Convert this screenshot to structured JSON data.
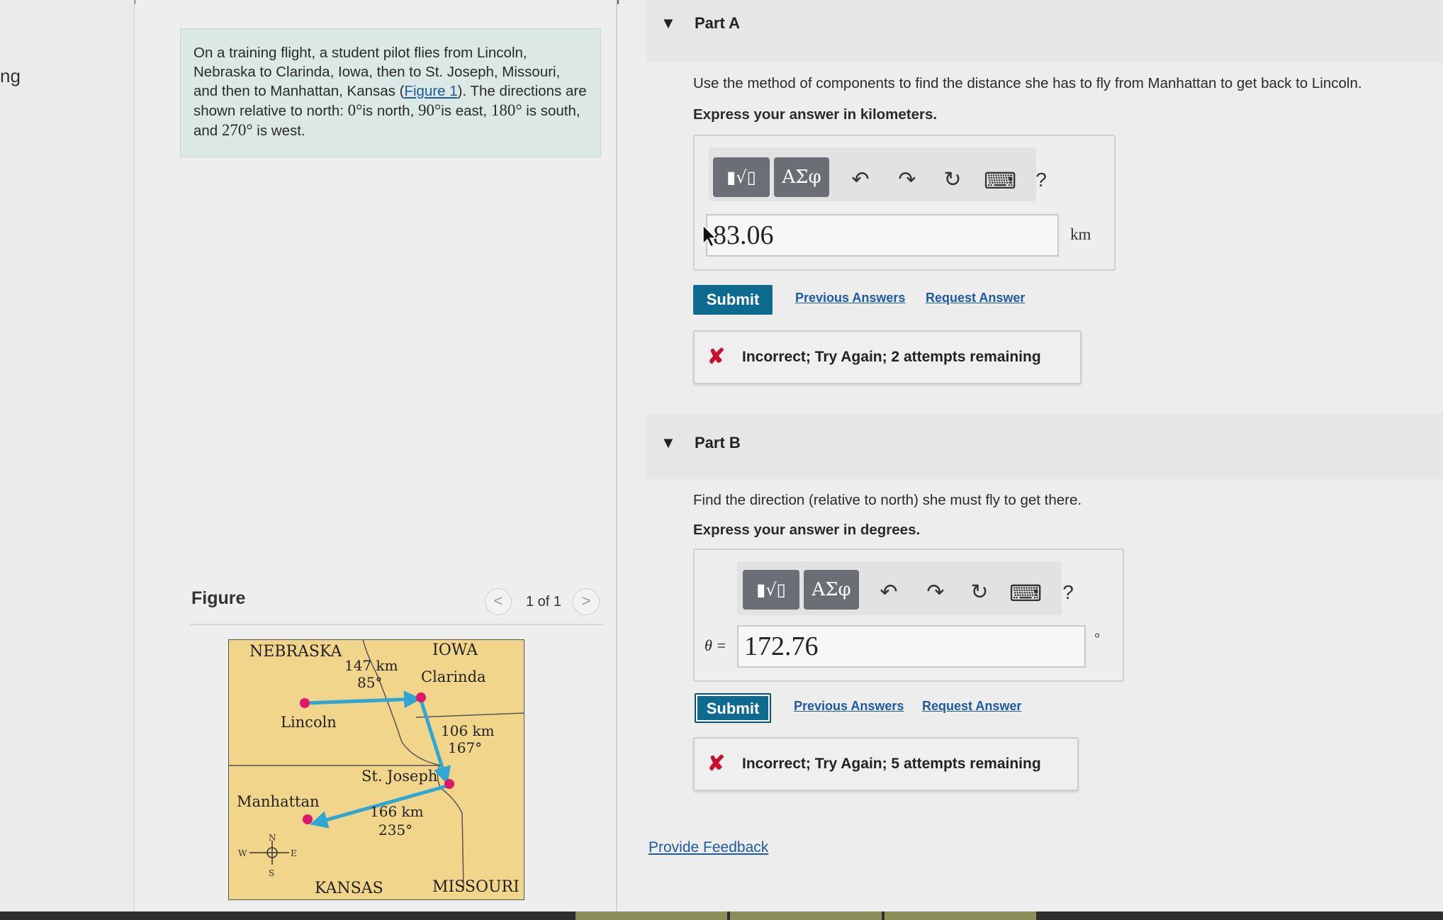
{
  "left_edge_text": "ng",
  "problem": {
    "segments": [
      {
        "t": "On a training flight, a student pilot flies from Lincoln, Nebraska to Clarinda, Iowa, then to St. Joseph, Missouri, and then to Manhattan, Kansas ("
      },
      {
        "t": "Figure 1",
        "link": true
      },
      {
        "t": "). The directions are shown relative to north: "
      },
      {
        "t": "0°",
        "deg": true
      },
      {
        "t": "is north, "
      },
      {
        "t": "90°",
        "deg": true
      },
      {
        "t": "is east, "
      },
      {
        "t": "180°",
        "deg": true
      },
      {
        "t": " is south, and "
      },
      {
        "t": "270°",
        "deg": true
      },
      {
        "t": " is west."
      }
    ]
  },
  "figure": {
    "title": "Figure",
    "prev_glyph": "<",
    "next_glyph": ">",
    "count": "1 of 1"
  },
  "map": {
    "states": {
      "nebraska": "NEBRASKA",
      "iowa": "IOWA",
      "kansas": "KANSAS",
      "missouri": "MISSOURI"
    },
    "cities": {
      "lincoln": "Lincoln",
      "clarinda": "Clarinda",
      "st_joseph": "St. Joseph",
      "manhattan": "Manhattan"
    },
    "legs": [
      {
        "distance": "147 km",
        "angle": "85°"
      },
      {
        "distance": "106 km",
        "angle": "167°"
      },
      {
        "distance": "166 km",
        "angle": "235°"
      }
    ],
    "compass": {
      "n": "N",
      "s": "S",
      "e": "E",
      "w": "W"
    },
    "colors": {
      "land": "#f0d58a",
      "route": "#2ea7d4",
      "city": "#e0176b"
    }
  },
  "part_a": {
    "title": "Part A",
    "question": "Use the method of components to find the distance she has to fly from Manhattan to get back to Lincoln.",
    "instruction": "Express your answer in kilometers.",
    "toolbar": {
      "templates_icon": "▮√▯",
      "symbols_label": "ΑΣφ",
      "undo": "↶",
      "redo": "↷",
      "reset": "↻",
      "keyboard": "⌨",
      "help": "?"
    },
    "answer_value": "83.06",
    "unit": "km",
    "submit_label": "Submit",
    "previous_answers": "Previous Answers",
    "request_answer": "Request Answer",
    "feedback_icon": "✘",
    "feedback": "Incorrect; Try Again; 2 attempts remaining"
  },
  "part_b": {
    "title": "Part B",
    "question": "Find the direction (relative to north) she must fly to get there.",
    "instruction": "Express your answer in degrees.",
    "toolbar": {
      "templates_icon": "▮√▯",
      "symbols_label": "ΑΣφ",
      "undo": "↶",
      "redo": "↷",
      "reset": "↻",
      "keyboard": "⌨",
      "help": "?"
    },
    "variable_label": "θ =",
    "answer_value": "172.76",
    "unit": "°",
    "submit_label": "Submit",
    "previous_answers": "Previous Answers",
    "request_answer": "Request Answer",
    "feedback_icon": "✘",
    "feedback": "Incorrect; Try Again; 5 attempts remaining"
  },
  "provide_feedback": "Provide Feedback"
}
